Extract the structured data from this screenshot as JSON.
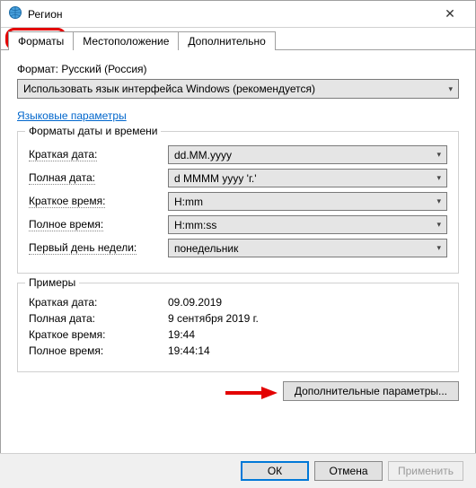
{
  "window": {
    "title": "Регион"
  },
  "tabs": {
    "formats": "Форматы",
    "location": "Местоположение",
    "additional": "Дополнительно"
  },
  "formatSection": {
    "label": "Формат:",
    "current": "Русский (Россия)",
    "selected": "Использовать язык интерфейса Windows (рекомендуется)"
  },
  "langLink": "Языковые параметры",
  "dtGroup": {
    "title": "Форматы даты и времени",
    "rows": {
      "shortDate": {
        "label": "Краткая дата:",
        "value": "dd.MM.yyyy"
      },
      "longDate": {
        "label": "Полная дата:",
        "value": "d MMMM yyyy 'г.'"
      },
      "shortTime": {
        "label": "Краткое время:",
        "value": "H:mm"
      },
      "longTime": {
        "label": "Полное время:",
        "value": "H:mm:ss"
      },
      "firstDay": {
        "label": "Первый день недели:",
        "value": "понедельник"
      }
    }
  },
  "exGroup": {
    "title": "Примеры",
    "rows": {
      "shortDate": {
        "label": "Краткая дата:",
        "value": "09.09.2019"
      },
      "longDate": {
        "label": "Полная дата:",
        "value": "9 сентября 2019 г."
      },
      "shortTime": {
        "label": "Краткое время:",
        "value": "19:44"
      },
      "longTime": {
        "label": "Полное время:",
        "value": "19:44:14"
      }
    }
  },
  "buttons": {
    "advanced": "Дополнительные параметры...",
    "ok": "ОК",
    "cancel": "Отмена",
    "apply": "Применить"
  }
}
